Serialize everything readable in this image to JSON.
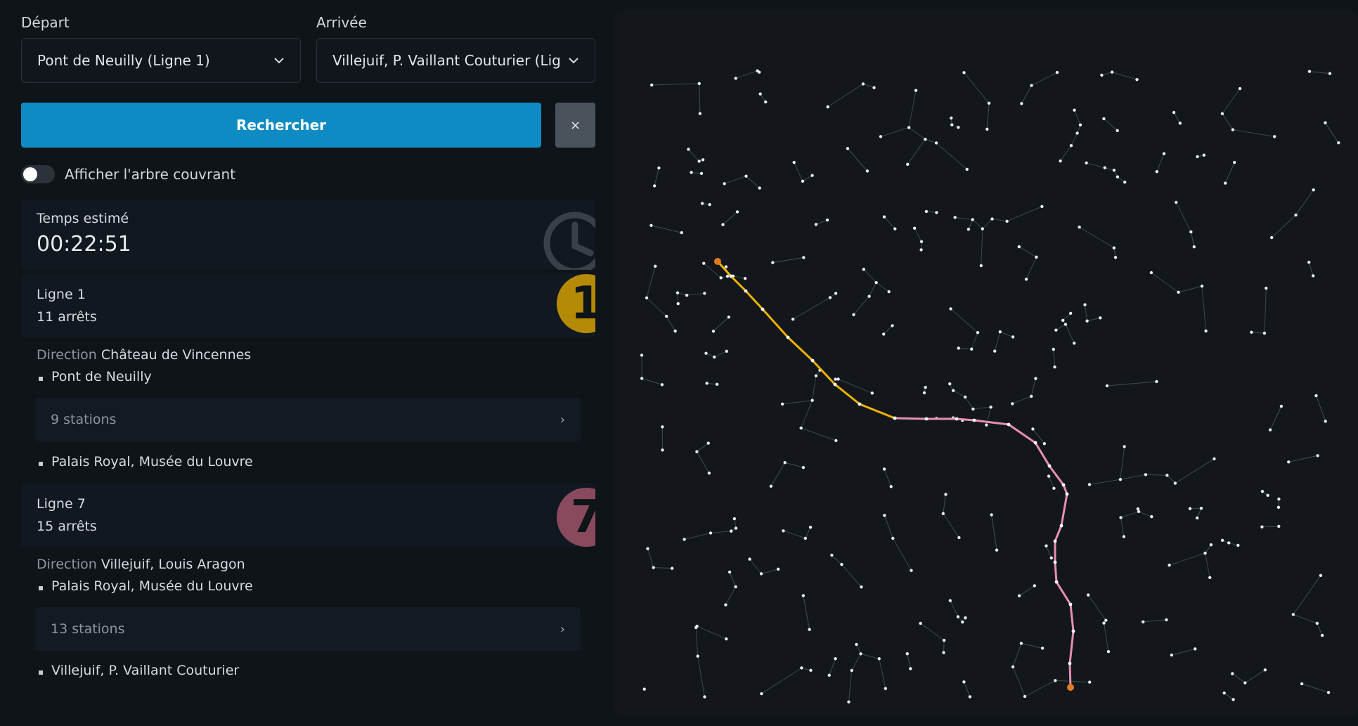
{
  "form": {
    "departure_label": "Départ",
    "departure_value": "Pont de Neuilly (Ligne 1)",
    "arrival_label": "Arrivée",
    "arrival_value": "Villejuif, P. Vaillant Couturier (Ligr",
    "search_label": "Rechercher",
    "clear_label": "×",
    "toggle_label": "Afficher l'arbre couvrant",
    "toggle_on": false
  },
  "result": {
    "time_label": "Temps estimé",
    "time_value": "00:22:51",
    "segments": [
      {
        "line_label": "Ligne 1",
        "badge": "1",
        "color": "#d4a20a",
        "stops": "11 arrêts",
        "direction_prefix": "Direction",
        "direction": "Château de Vincennes",
        "start": "Pont de Neuilly",
        "middle": "9 stations",
        "end": "Palais Royal, Musée du Louvre"
      },
      {
        "line_label": "Ligne 7",
        "badge": "7",
        "color": "#e89bb8",
        "stops": "15 arrêts",
        "direction_prefix": "Direction",
        "direction": "Villejuif, Louis Aragon",
        "start": "Palais Royal, Musée du Louvre",
        "middle": "13 stations",
        "end": "Villejuif, P. Vaillant Couturier"
      }
    ]
  },
  "map": {
    "background": "#13171c",
    "route_colors": [
      "#f0b400",
      "#e68fb4"
    ],
    "endpoint_color": "#e07a1c"
  }
}
